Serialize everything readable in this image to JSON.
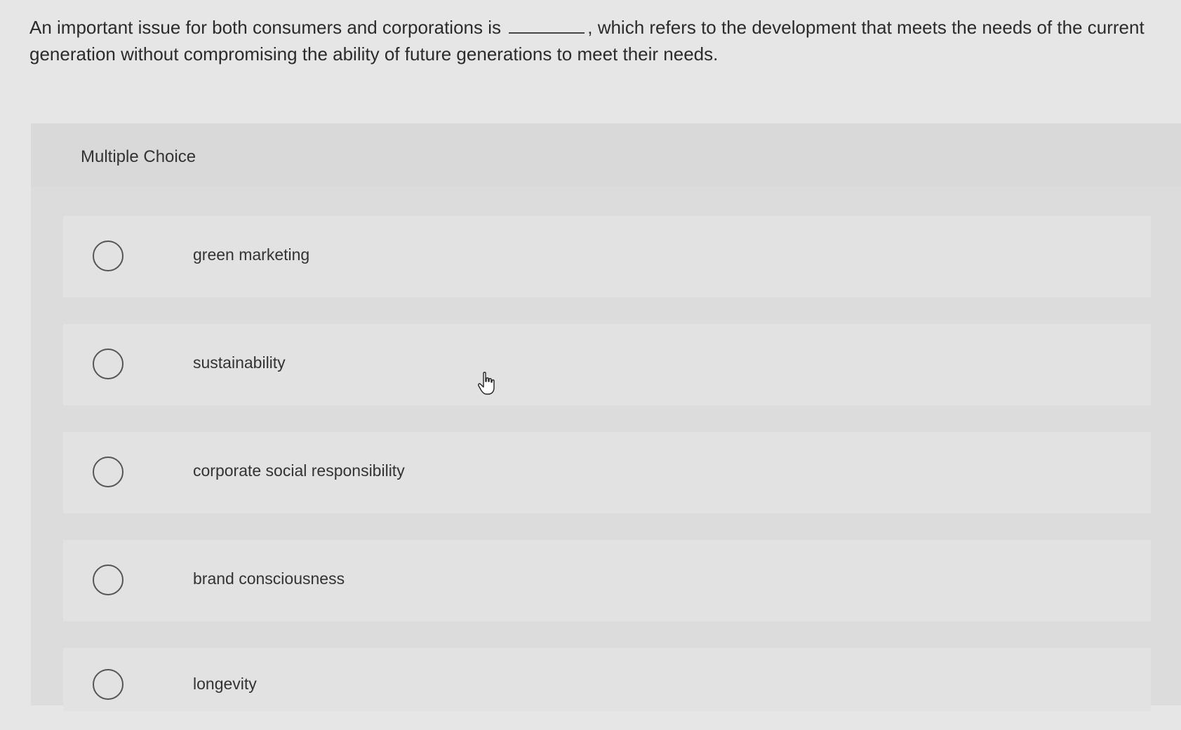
{
  "question": {
    "text_before": "An important issue for both consumers and corporations is",
    "text_after": ", which refers to the development that meets the needs of the current generation without compromising the ability of future generations to meet their needs."
  },
  "mc": {
    "title": "Multiple Choice",
    "options": [
      {
        "label": "green marketing"
      },
      {
        "label": "sustainability"
      },
      {
        "label": "corporate social responsibility"
      },
      {
        "label": "brand consciousness"
      },
      {
        "label": "longevity"
      }
    ]
  },
  "icons": {
    "cursor": "hand-pointer-icon",
    "radio": "radio-circle-icon"
  }
}
